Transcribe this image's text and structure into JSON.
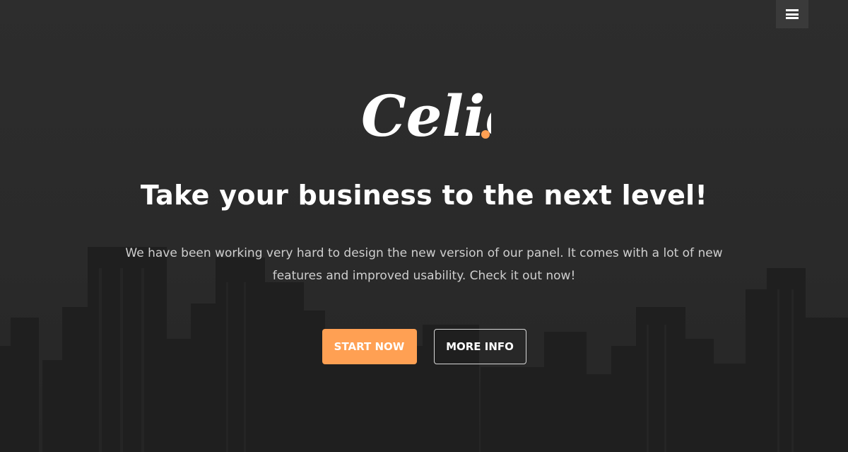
{
  "header": {
    "menu_icon": "hamburger-menu-icon"
  },
  "logo": {
    "text": "Celic",
    "accent_color": "#ffa053"
  },
  "hero": {
    "headline": "Take your business to the next level!",
    "description": "We have been working very hard to design the new version of our panel. It comes with a lot of new features and improved usability. Check it out now!",
    "background_image": "city-skyline-image"
  },
  "actions": {
    "primary_label": "START NOW",
    "secondary_label": "MORE INFO"
  },
  "colors": {
    "accent": "#ffa053",
    "background": "#2b2b2b",
    "text": "#ffffff"
  }
}
